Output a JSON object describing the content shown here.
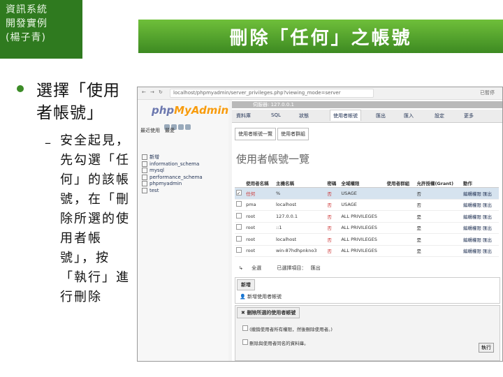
{
  "slide": {
    "corner_lines": [
      "資訊系統",
      "開發實例",
      "(楊子青)"
    ],
    "title": "刪除「任何」之帳號",
    "bullet1": "選擇「使用者帳號」",
    "dash": "–",
    "bullet2": "安全起見，先勾選「任何」的該帳號，在「刪除所選的使用者帳號」，按「執行」進行刪除"
  },
  "browser": {
    "url": "localhost/phpmyadmin/server_privileges.php?viewing_mode=server",
    "menu_right": "已暫停"
  },
  "pma": {
    "logo_a": "php",
    "logo_b": "MyAdmin",
    "recent": "最近使用　最愛",
    "databases": [
      "新增",
      "information_schema",
      "mysql",
      "performance_schema",
      "phpmyadmin",
      "test"
    ],
    "server": "伺服器: 127.0.0.1",
    "tabs": [
      "資料庫",
      "SQL",
      "狀態",
      "使用者帳號",
      "匯出",
      "匯入",
      "設定",
      "更多"
    ],
    "subtabs": [
      "使用者帳號一覽",
      "使用者群組"
    ],
    "heading": "使用者帳號一覽",
    "columns": [
      "使用者名稱",
      "主機名稱",
      "密碼",
      "全域權限",
      "使用者群組",
      "允許授權(Grant)",
      "動作"
    ],
    "rows": [
      [
        "任何",
        "%",
        "否",
        "USAGE",
        "",
        "否"
      ],
      [
        "pma",
        "localhost",
        "否",
        "USAGE",
        "",
        "否"
      ],
      [
        "root",
        "127.0.0.1",
        "否",
        "ALL PRIVILEGES",
        "",
        "是"
      ],
      [
        "root",
        "::1",
        "否",
        "ALL PRIVILEGES",
        "",
        "是"
      ],
      [
        "root",
        "localhost",
        "否",
        "ALL PRIVILEGES",
        "",
        "是"
      ],
      [
        "root",
        "win-87hdhpnkno3",
        "否",
        "ALL PRIVILEGES",
        "",
        "是"
      ]
    ],
    "edit_label": "編輯權限",
    "export_label": "匯出",
    "bulk": [
      "全選",
      "已選擇項目：",
      "匯出"
    ],
    "new_header": "新增",
    "new_link": "新增使用者帳號",
    "delete_header": "刪除所選的使用者帳號",
    "delete_note": "(撤銷使用者所有權限，然後刪除使用者。)",
    "drop_db_label": "刪除與使用者同名的資料庫。",
    "go": "執行"
  }
}
